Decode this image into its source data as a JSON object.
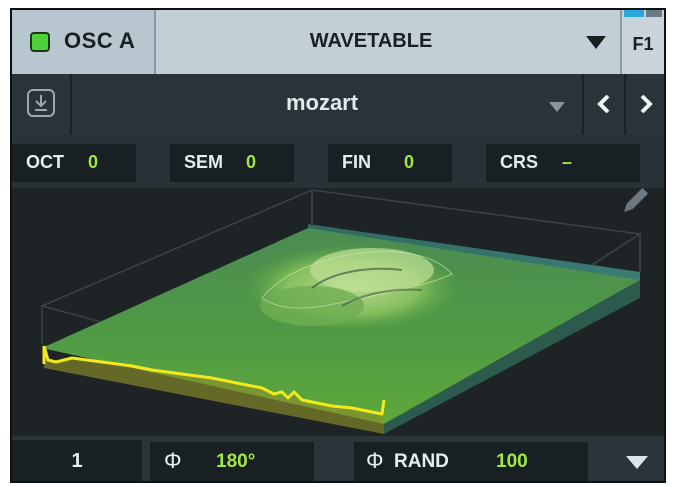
{
  "oscillator": {
    "name": "OSC A",
    "enabled": true,
    "type": "WAVETABLE",
    "filter_route": "F1",
    "led_color": "#4cd13a",
    "route_colors": [
      "#29a8e0",
      "#6a7b86"
    ]
  },
  "preset": {
    "name": "mozart",
    "save_icon": "save-icon",
    "prev_icon": "chevron-left-icon",
    "next_icon": "chevron-right-icon"
  },
  "tuning": [
    {
      "label": "OCT",
      "value": "0"
    },
    {
      "label": "SEM",
      "value": "0"
    },
    {
      "label": "FIN",
      "value": "0"
    },
    {
      "label": "CRS",
      "value": "–"
    }
  ],
  "wavetable_view": {
    "edit_icon": "pencil-icon",
    "accent_color": "#f2ea1d",
    "surface_color": "#5aa43f"
  },
  "bottom": {
    "unison_voices": "1",
    "phase_symbol": "Φ",
    "phase_value": "180°",
    "rand_symbol": "Φ",
    "rand_label": "RAND",
    "rand_value": "100"
  },
  "value_color": "#9fe844"
}
